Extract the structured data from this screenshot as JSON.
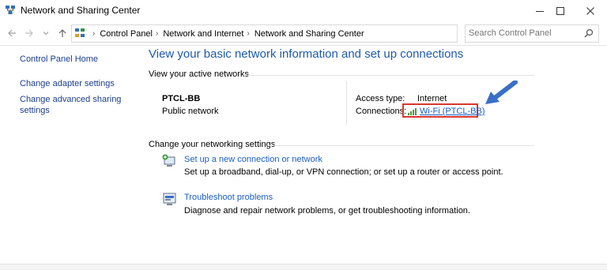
{
  "window": {
    "title": "Network and Sharing Center"
  },
  "address_bar": {
    "breadcrumbs": [
      "Control Panel",
      "Network and Internet",
      "Network and Sharing Center"
    ]
  },
  "search": {
    "placeholder": "Search Control Panel"
  },
  "sidebar": {
    "items": [
      {
        "label": "Control Panel Home"
      },
      {
        "label": "Change adapter settings"
      },
      {
        "label": "Change advanced sharing settings"
      }
    ]
  },
  "main": {
    "heading": "View your basic network information and set up connections",
    "active_networks_label": "View your active networks",
    "network": {
      "name": "PTCL-BB",
      "type": "Public network",
      "access_type_label": "Access type:",
      "access_type_value": "Internet",
      "connections_label": "Connections:",
      "connection_link": "Wi-Fi (PTCL-BB)"
    },
    "change_settings_label": "Change your networking settings",
    "tasks": [
      {
        "title": "Set up a new connection or network",
        "description": "Set up a broadband, dial-up, or VPN connection; or set up a router or access point."
      },
      {
        "title": "Troubleshoot problems",
        "description": "Diagnose and repair network problems, or get troubleshooting information."
      }
    ]
  },
  "colors": {
    "heading": "#1e5aa8",
    "link": "#1a5fc4",
    "highlight": "#d9372f",
    "annotation_arrow": "#3a6fc8"
  }
}
